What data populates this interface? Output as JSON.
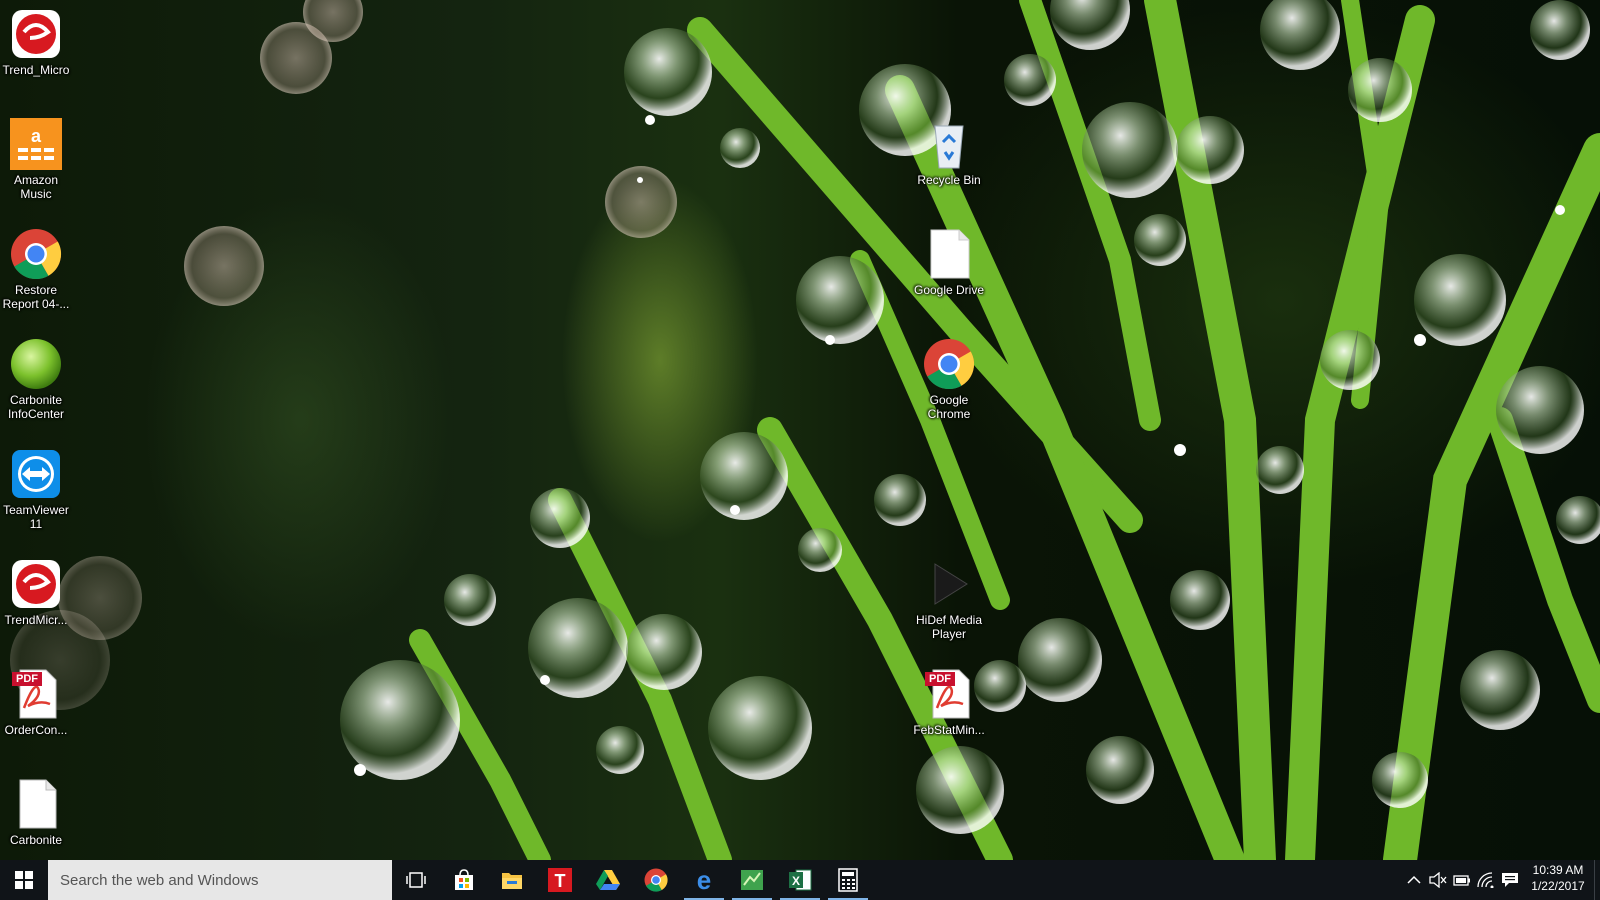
{
  "desktop": {
    "left_column": [
      {
        "label": "Trend_Micro"
      },
      {
        "label": "Amazon\nMusic"
      },
      {
        "label": "Restore\nReport 04-..."
      },
      {
        "label": "Carbonite\nInfoCenter"
      },
      {
        "label": "TeamViewer\n11"
      },
      {
        "label": "TrendMicr..."
      },
      {
        "label": "OrderCon..."
      },
      {
        "label": "Carbonite"
      }
    ],
    "middle_column": [
      {
        "label": "Recycle Bin"
      },
      {
        "label": "Google Drive"
      },
      {
        "label": "Google\nChrome"
      },
      {
        "label": "HiDef Media\nPlayer"
      },
      {
        "label": "FebStatMin..."
      }
    ],
    "pdf_badge": "PDF"
  },
  "taskbar": {
    "search_placeholder": "Search the web and Windows",
    "pinned": [
      {
        "name": "task-view"
      },
      {
        "name": "store"
      },
      {
        "name": "file-explorer"
      },
      {
        "name": "trend-micro"
      },
      {
        "name": "google-drive"
      },
      {
        "name": "chrome"
      },
      {
        "name": "edge"
      },
      {
        "name": "app-green"
      },
      {
        "name": "excel"
      },
      {
        "name": "calculator"
      }
    ],
    "tray_icons": [
      "chevron-up",
      "volume-muted",
      "battery",
      "wifi",
      "action-center"
    ],
    "clock": {
      "time": "10:39 AM",
      "date": "1/22/2017"
    },
    "colors": {
      "taskbar_bg": "#101418",
      "active_underline": "#7fb4e6"
    }
  }
}
